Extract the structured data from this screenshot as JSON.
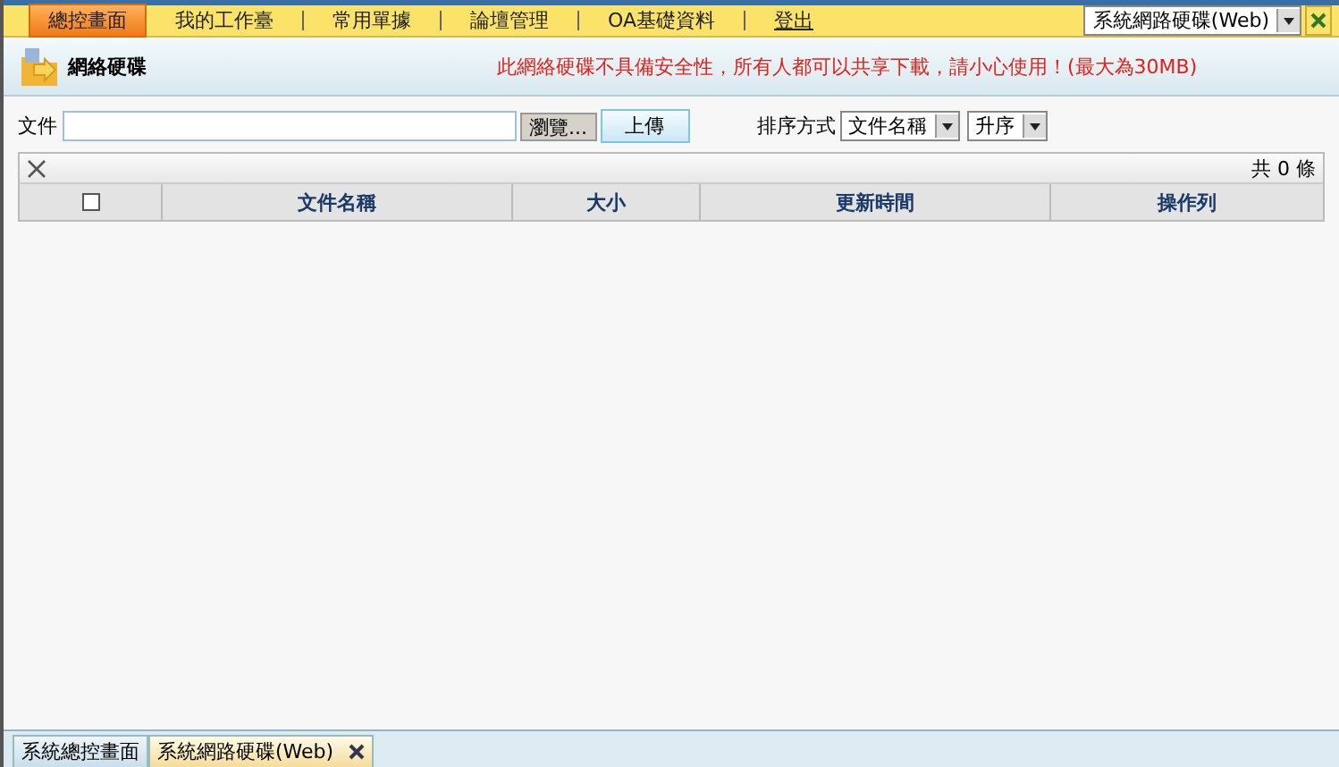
{
  "top_menu": {
    "items": [
      {
        "label": "總控畫面",
        "selected": true
      },
      {
        "label": "我的工作臺",
        "selected": false
      },
      {
        "label": "常用單據",
        "selected": false
      },
      {
        "label": "論壇管理",
        "selected": false
      },
      {
        "label": "OA基礎資料",
        "selected": false
      },
      {
        "label": "登出",
        "selected": false
      }
    ],
    "module_select": {
      "value": "系統網路硬碟(Web)"
    }
  },
  "header": {
    "title": "網絡硬碟",
    "notice": "此網絡硬碟不具備安全性，所有人都可以共享下載，請小心使用！(最大為30MB)"
  },
  "upload": {
    "label": "文件",
    "browse_button": "瀏覽...",
    "upload_button": "上傳"
  },
  "sort": {
    "label": "排序方式",
    "field": "文件名稱",
    "order": "升序"
  },
  "table": {
    "count": "共 0 條",
    "select_all": {
      "checked": false
    },
    "columns": [
      "文件名稱",
      "大小",
      "更新時間",
      "操作列"
    ]
  },
  "bottom_tabs": [
    {
      "label": "系統總控畫面",
      "selected": false,
      "closable": false
    },
    {
      "label": "系統網路硬碟(Web)",
      "selected": true,
      "closable": true
    }
  ]
}
